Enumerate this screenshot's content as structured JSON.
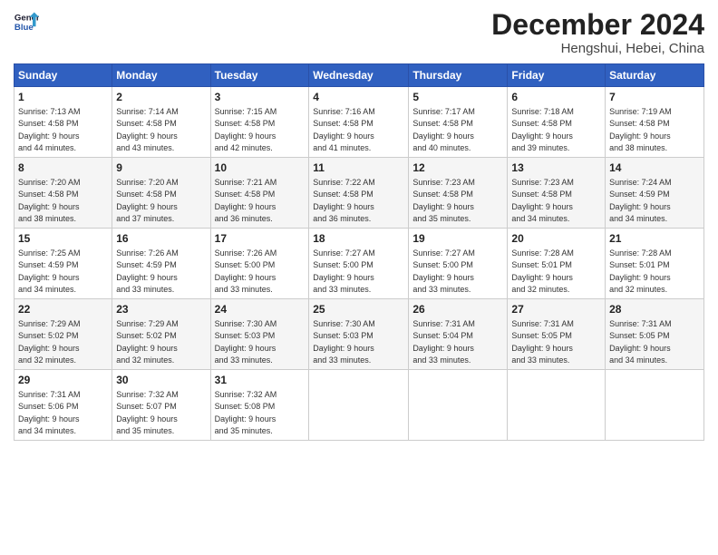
{
  "logo": {
    "line1": "General",
    "line2": "Blue"
  },
  "title": "December 2024",
  "subtitle": "Hengshui, Hebei, China",
  "weekdays": [
    "Sunday",
    "Monday",
    "Tuesday",
    "Wednesday",
    "Thursday",
    "Friday",
    "Saturday"
  ],
  "weeks": [
    [
      {
        "day": "1",
        "info": "Sunrise: 7:13 AM\nSunset: 4:58 PM\nDaylight: 9 hours\nand 44 minutes."
      },
      {
        "day": "2",
        "info": "Sunrise: 7:14 AM\nSunset: 4:58 PM\nDaylight: 9 hours\nand 43 minutes."
      },
      {
        "day": "3",
        "info": "Sunrise: 7:15 AM\nSunset: 4:58 PM\nDaylight: 9 hours\nand 42 minutes."
      },
      {
        "day": "4",
        "info": "Sunrise: 7:16 AM\nSunset: 4:58 PM\nDaylight: 9 hours\nand 41 minutes."
      },
      {
        "day": "5",
        "info": "Sunrise: 7:17 AM\nSunset: 4:58 PM\nDaylight: 9 hours\nand 40 minutes."
      },
      {
        "day": "6",
        "info": "Sunrise: 7:18 AM\nSunset: 4:58 PM\nDaylight: 9 hours\nand 39 minutes."
      },
      {
        "day": "7",
        "info": "Sunrise: 7:19 AM\nSunset: 4:58 PM\nDaylight: 9 hours\nand 38 minutes."
      }
    ],
    [
      {
        "day": "8",
        "info": "Sunrise: 7:20 AM\nSunset: 4:58 PM\nDaylight: 9 hours\nand 38 minutes."
      },
      {
        "day": "9",
        "info": "Sunrise: 7:20 AM\nSunset: 4:58 PM\nDaylight: 9 hours\nand 37 minutes."
      },
      {
        "day": "10",
        "info": "Sunrise: 7:21 AM\nSunset: 4:58 PM\nDaylight: 9 hours\nand 36 minutes."
      },
      {
        "day": "11",
        "info": "Sunrise: 7:22 AM\nSunset: 4:58 PM\nDaylight: 9 hours\nand 36 minutes."
      },
      {
        "day": "12",
        "info": "Sunrise: 7:23 AM\nSunset: 4:58 PM\nDaylight: 9 hours\nand 35 minutes."
      },
      {
        "day": "13",
        "info": "Sunrise: 7:23 AM\nSunset: 4:58 PM\nDaylight: 9 hours\nand 34 minutes."
      },
      {
        "day": "14",
        "info": "Sunrise: 7:24 AM\nSunset: 4:59 PM\nDaylight: 9 hours\nand 34 minutes."
      }
    ],
    [
      {
        "day": "15",
        "info": "Sunrise: 7:25 AM\nSunset: 4:59 PM\nDaylight: 9 hours\nand 34 minutes."
      },
      {
        "day": "16",
        "info": "Sunrise: 7:26 AM\nSunset: 4:59 PM\nDaylight: 9 hours\nand 33 minutes."
      },
      {
        "day": "17",
        "info": "Sunrise: 7:26 AM\nSunset: 5:00 PM\nDaylight: 9 hours\nand 33 minutes."
      },
      {
        "day": "18",
        "info": "Sunrise: 7:27 AM\nSunset: 5:00 PM\nDaylight: 9 hours\nand 33 minutes."
      },
      {
        "day": "19",
        "info": "Sunrise: 7:27 AM\nSunset: 5:00 PM\nDaylight: 9 hours\nand 33 minutes."
      },
      {
        "day": "20",
        "info": "Sunrise: 7:28 AM\nSunset: 5:01 PM\nDaylight: 9 hours\nand 32 minutes."
      },
      {
        "day": "21",
        "info": "Sunrise: 7:28 AM\nSunset: 5:01 PM\nDaylight: 9 hours\nand 32 minutes."
      }
    ],
    [
      {
        "day": "22",
        "info": "Sunrise: 7:29 AM\nSunset: 5:02 PM\nDaylight: 9 hours\nand 32 minutes."
      },
      {
        "day": "23",
        "info": "Sunrise: 7:29 AM\nSunset: 5:02 PM\nDaylight: 9 hours\nand 32 minutes."
      },
      {
        "day": "24",
        "info": "Sunrise: 7:30 AM\nSunset: 5:03 PM\nDaylight: 9 hours\nand 33 minutes."
      },
      {
        "day": "25",
        "info": "Sunrise: 7:30 AM\nSunset: 5:03 PM\nDaylight: 9 hours\nand 33 minutes."
      },
      {
        "day": "26",
        "info": "Sunrise: 7:31 AM\nSunset: 5:04 PM\nDaylight: 9 hours\nand 33 minutes."
      },
      {
        "day": "27",
        "info": "Sunrise: 7:31 AM\nSunset: 5:05 PM\nDaylight: 9 hours\nand 33 minutes."
      },
      {
        "day": "28",
        "info": "Sunrise: 7:31 AM\nSunset: 5:05 PM\nDaylight: 9 hours\nand 34 minutes."
      }
    ],
    [
      {
        "day": "29",
        "info": "Sunrise: 7:31 AM\nSunset: 5:06 PM\nDaylight: 9 hours\nand 34 minutes."
      },
      {
        "day": "30",
        "info": "Sunrise: 7:32 AM\nSunset: 5:07 PM\nDaylight: 9 hours\nand 35 minutes."
      },
      {
        "day": "31",
        "info": "Sunrise: 7:32 AM\nSunset: 5:08 PM\nDaylight: 9 hours\nand 35 minutes."
      },
      null,
      null,
      null,
      null
    ]
  ]
}
